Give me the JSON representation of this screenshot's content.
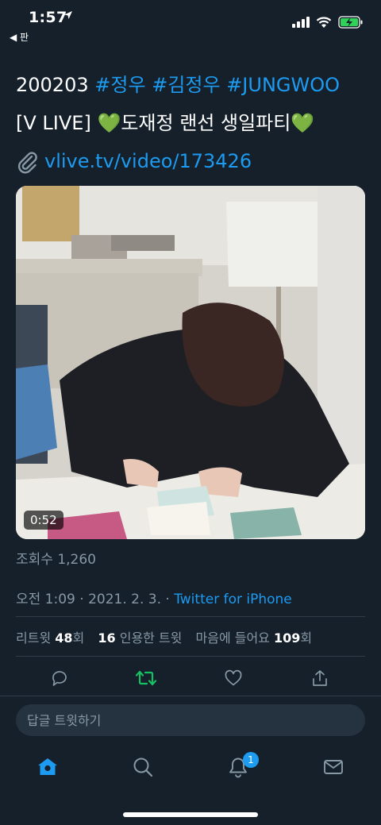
{
  "status_bar": {
    "time": "1:57",
    "back_app": "◀ 판"
  },
  "tweet": {
    "line1": {
      "date": "200203",
      "tags": [
        "#정우",
        "#김정우",
        "#JUNGWOO"
      ]
    },
    "line2": {
      "prefix": "[V LIVE] ",
      "heart": "💚",
      "title": "도재정 랜선 생일파티"
    },
    "line3": {
      "link": "vlive.tv/video/173426"
    }
  },
  "media": {
    "duration": "0:52"
  },
  "views": "조회수 1,260",
  "meta": {
    "time_date": "오전 1:09 · 2021. 2. 3. · ",
    "source": "Twitter for iPhone"
  },
  "stats": {
    "retweet_label": "리트윗",
    "retweet_count": "48",
    "retweet_unit": "회",
    "quote_count": "16",
    "quote_label": "인용한 트윗",
    "like_label": "마음에 들어요",
    "like_count": "109",
    "like_unit": "회"
  },
  "reply": {
    "placeholder": "답글 트윗하기"
  },
  "tab_bar": {
    "notification_badge": "1"
  },
  "colors": {
    "background": "#15202b",
    "accent": "#1d9bf0",
    "retweet_active": "#17bf63"
  }
}
